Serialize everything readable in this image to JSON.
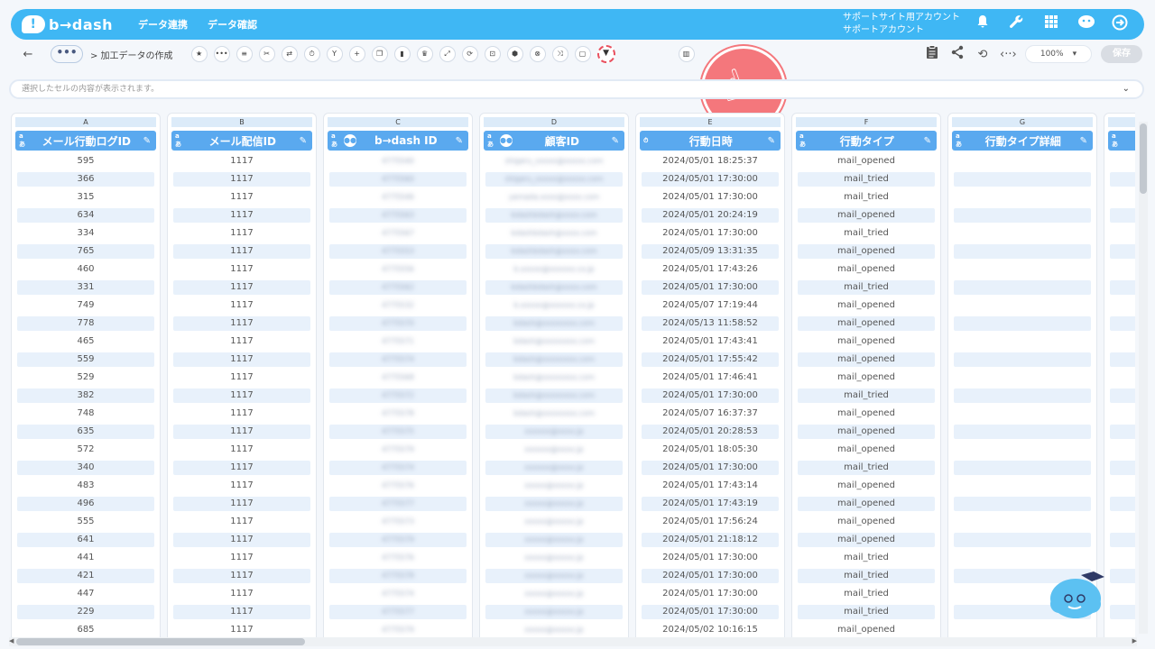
{
  "topbar": {
    "logo_text": "b→dash",
    "logo_mark": "!",
    "nav": [
      "データ連携",
      "データ確認"
    ],
    "account_line1": "サポートサイト用アカウント",
    "account_line2": "サポートアカウント"
  },
  "toolbar": {
    "back": "←",
    "more": "•••",
    "breadcrumb": "> 加工データの作成",
    "tools": [
      {
        "name": "favorite-icon",
        "glyph": "★"
      },
      {
        "name": "more-icon",
        "glyph": "•••"
      },
      {
        "name": "list-icon",
        "glyph": "≡"
      },
      {
        "name": "tools-icon",
        "glyph": "✂"
      },
      {
        "name": "swap-icon",
        "glyph": "⇄"
      },
      {
        "name": "timer-icon",
        "glyph": "⏱"
      },
      {
        "name": "merge-icon",
        "glyph": "Y"
      },
      {
        "name": "add-icon",
        "glyph": "+"
      },
      {
        "name": "copy-icon",
        "glyph": "❐"
      },
      {
        "name": "delete-icon",
        "glyph": "▮"
      },
      {
        "name": "crown-icon",
        "glyph": "♛"
      },
      {
        "name": "expand-icon",
        "glyph": "⤢"
      },
      {
        "name": "repeat-icon",
        "glyph": "⟳"
      },
      {
        "name": "lock-icon",
        "glyph": "⊡"
      },
      {
        "name": "package-icon",
        "glyph": "⬢"
      },
      {
        "name": "cancel-icon",
        "glyph": "⊗"
      },
      {
        "name": "shuffle-icon",
        "glyph": "⤨"
      },
      {
        "name": "frame-icon",
        "glyph": "▢"
      }
    ],
    "filter_glyph": "▼",
    "zoom_value": "100%",
    "zoom_chevron": "▾",
    "save_label": "保存"
  },
  "cellbar": {
    "placeholder": "選択したセルの内容が表示されます。",
    "chevron": "⌄"
  },
  "columns": [
    {
      "letter": "A",
      "title": "メール行動ログID",
      "type": "a あ",
      "people": false
    },
    {
      "letter": "B",
      "title": "メール配信ID",
      "type": "a あ",
      "people": false
    },
    {
      "letter": "C",
      "title": "b→dash ID",
      "type": "a あ",
      "people": true
    },
    {
      "letter": "D",
      "title": "顧客ID",
      "type": "a あ",
      "people": true
    },
    {
      "letter": "E",
      "title": "行動日時",
      "type": "⏱",
      "people": false
    },
    {
      "letter": "F",
      "title": "行動タイプ",
      "type": "a あ",
      "people": false
    },
    {
      "letter": "G",
      "title": "行動タイプ詳細",
      "type": "a あ",
      "people": false
    }
  ],
  "rows": {
    "A": [
      "595",
      "366",
      "315",
      "634",
      "334",
      "765",
      "460",
      "331",
      "749",
      "778",
      "465",
      "559",
      "529",
      "382",
      "748",
      "635",
      "572",
      "340",
      "483",
      "496",
      "555",
      "641",
      "441",
      "421",
      "447",
      "229",
      "685"
    ],
    "B": [
      "1117",
      "1117",
      "1117",
      "1117",
      "1117",
      "1117",
      "1117",
      "1117",
      "1117",
      "1117",
      "1117",
      "1117",
      "1117",
      "1117",
      "1117",
      "1117",
      "1117",
      "1117",
      "1117",
      "1117",
      "1117",
      "1117",
      "1117",
      "1117",
      "1117",
      "1117",
      "1117"
    ],
    "E": [
      "2024/05/01 18:25:37",
      "2024/05/01 17:30:00",
      "2024/05/01 17:30:00",
      "2024/05/01 20:24:19",
      "2024/05/01 17:30:00",
      "2024/05/09 13:31:35",
      "2024/05/01 17:43:26",
      "2024/05/01 17:30:00",
      "2024/05/07 17:19:44",
      "2024/05/13 11:58:52",
      "2024/05/01 17:43:41",
      "2024/05/01 17:55:42",
      "2024/05/01 17:46:41",
      "2024/05/01 17:30:00",
      "2024/05/07 16:37:37",
      "2024/05/01 20:28:53",
      "2024/05/01 18:05:30",
      "2024/05/01 17:30:00",
      "2024/05/01 17:43:14",
      "2024/05/01 17:43:19",
      "2024/05/01 17:56:24",
      "2024/05/01 21:18:12",
      "2024/05/01 17:30:00",
      "2024/05/01 17:30:00",
      "2024/05/01 17:30:00",
      "2024/05/01 17:30:00",
      "2024/05/02 10:16:15"
    ],
    "F": [
      "mail_opened",
      "mail_tried",
      "mail_tried",
      "mail_opened",
      "mail_tried",
      "mail_opened",
      "mail_opened",
      "mail_tried",
      "mail_opened",
      "mail_opened",
      "mail_opened",
      "mail_opened",
      "mail_opened",
      "mail_tried",
      "mail_opened",
      "mail_opened",
      "mail_opened",
      "mail_tried",
      "mail_opened",
      "mail_opened",
      "mail_opened",
      "mail_opened",
      "mail_tried",
      "mail_tried",
      "mail_tried",
      "mail_tried",
      "mail_opened"
    ]
  }
}
